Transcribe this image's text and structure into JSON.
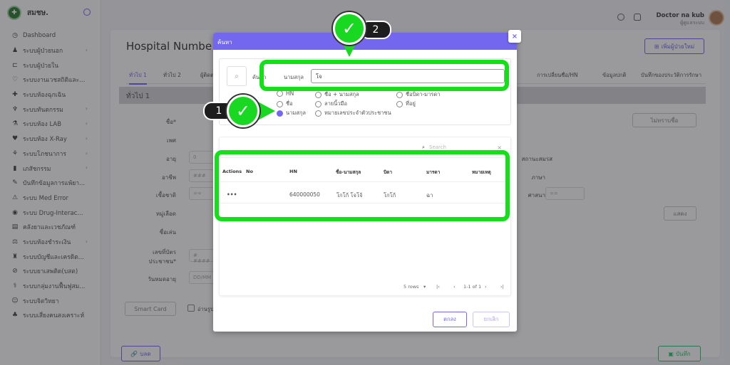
{
  "sidebar": {
    "brand": "สมชษ.",
    "items": [
      {
        "icon": "dashboard-icon",
        "label": "Dashboard",
        "chevron": false
      },
      {
        "icon": "walk-icon",
        "label": "ระบบผู้ป่วยนอก",
        "chevron": true
      },
      {
        "icon": "bed-icon",
        "label": "ระบบผู้ป่วยใน",
        "chevron": false
      },
      {
        "icon": "stethoscope-icon",
        "label": "ระบบงานเวชสถิติและ...",
        "chevron": false
      },
      {
        "icon": "plus-icon",
        "label": "ระบบห้องฉุกเฉิน",
        "chevron": false
      },
      {
        "icon": "tooth-icon",
        "label": "ระบบทันตกรรม",
        "chevron": true
      },
      {
        "icon": "flask-icon",
        "label": "ระบบห้อง LAB",
        "chevron": true
      },
      {
        "icon": "heart-icon",
        "label": "ระบบห้อง X-Ray",
        "chevron": true
      },
      {
        "icon": "nutrition-icon",
        "label": "ระบบโภชนาการ",
        "chevron": true
      },
      {
        "icon": "pharmacy-icon",
        "label": "เภสัชกรรม",
        "chevron": true
      },
      {
        "icon": "record-icon",
        "label": "บันทึกข้อมูลการแพ้ยา...",
        "chevron": false
      },
      {
        "icon": "error-icon",
        "label": "ระบบ Med Error",
        "chevron": false
      },
      {
        "icon": "drug-icon",
        "label": "ระบบ Drug-Interac...",
        "chevron": false
      },
      {
        "icon": "warehouse-icon",
        "label": "คลังยาและเวชภัณฑ์",
        "chevron": false
      },
      {
        "icon": "cashier-icon",
        "label": "ระบบห้องชำระเงิน",
        "chevron": true
      },
      {
        "icon": "account-icon",
        "label": "ระบบบัญชีและเครดิต...",
        "chevron": false
      },
      {
        "icon": "narcotic-icon",
        "label": "ระบบยาเสพติด(บสต)",
        "chevron": false
      },
      {
        "icon": "rehab-icon",
        "label": "ระบบกลุ่มงานฟื้นฟูสม...",
        "chevron": false
      },
      {
        "icon": "psych-icon",
        "label": "ระบบจิตวิทยา",
        "chevron": false
      },
      {
        "icon": "support-icon",
        "label": "ระบบเสี่ยงคนสงเคราะห์",
        "chevron": false
      }
    ]
  },
  "topbar": {
    "user_name": "Doctor na kub",
    "user_role": "ผู้ดูแลระบบ"
  },
  "page": {
    "title": "Hospital Numbe",
    "add_button": "เพิ่มผู้ป่วยใหม่",
    "tabs": [
      "ทั่วไป 1",
      "ทั่วไป 2",
      "ผู้ติดต",
      "การเปลี่ยนชื่อ/HN",
      "ข้อมูลปกติ",
      "บันทึกของประวัติการรักษา"
    ],
    "section_title": "ทั่วไป 1",
    "labels": {
      "name": "ชื่อ*",
      "sex": "เพศ",
      "age": "อายุ",
      "occupation": "อาชีพ",
      "race": "เชื้อชาติ",
      "blood": "หมู่เลือด",
      "nickname": "ชื่อเล่น",
      "idcard": "เลขที่บัตรประชาชน*",
      "expiry": "วันหมดอายุ",
      "marital": "สถานะสมรส",
      "language": "ภาษา",
      "religion": "ศาสนา"
    },
    "input_values": {
      "age": "0",
      "occupation": "###",
      "race": "==",
      "idcard": "# ####",
      "expiry": "DD/MM",
      "religion": "=="
    },
    "smart_card": "Smart Card",
    "checkbox_label": "อ่านรูป",
    "link_button": "บลด",
    "save_button": "บันทึก",
    "side_button_1": "ไม่ทราบชื่อ",
    "side_button_2": "แสดง"
  },
  "modal": {
    "title": "ค้นหา",
    "close": "×",
    "search_label": "ค้นหา",
    "field_label": "นามสกุล",
    "field_value": "โจ",
    "radios": [
      {
        "label": "HN",
        "checked": false
      },
      {
        "label": "ชื่อ + นามสกุล",
        "checked": false
      },
      {
        "label": "ชื่อบิดา-มารดา",
        "checked": false
      },
      {
        "label": "ชื่อ",
        "checked": false
      },
      {
        "label": "ลายนิ้วมือ",
        "checked": false
      },
      {
        "label": "ที่อยู่",
        "checked": false
      },
      {
        "label": "นามสกุล",
        "checked": true
      },
      {
        "label": "หมายเลขประจำตัวประชาชน",
        "checked": false
      }
    ],
    "table_search_placeholder": "Search",
    "columns": [
      "Actions",
      "No",
      "HN",
      "ชื่อ-นามสกุล",
      "บิดา",
      "มารดา",
      "หมายเหตุ"
    ],
    "rows": [
      {
        "actions": "•••",
        "no": "",
        "hn": "640000050",
        "name": "โกโก้ โจโจ้",
        "father": "โกโก้",
        "mother": "ฉา",
        "note": ""
      }
    ],
    "pager": {
      "rows_per_page": "5 rows",
      "range": "1-1 of 1"
    },
    "ok_button": "ตกลง",
    "cancel_button": "ยกเลิก"
  },
  "annotations": {
    "step_1": "1",
    "step_2": "2",
    "highlight_color": "#14e01a"
  },
  "colors": {
    "accent": "#7367f0",
    "highlight": "#14e01a"
  }
}
